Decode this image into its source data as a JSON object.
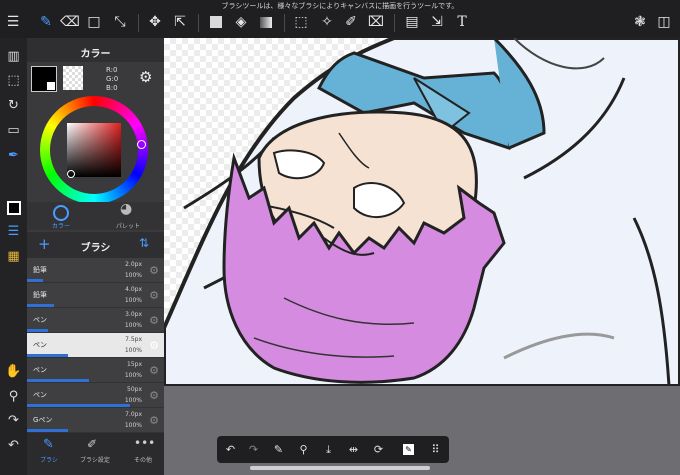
{
  "top_hint": "ブラシツールは、様々なブラシによりキャンバスに描画を行うツールです。",
  "color_panel": {
    "title": "カラー",
    "rgb": {
      "r": "R:0",
      "g": "G:0",
      "b": "B:0"
    },
    "tabs": [
      {
        "label": "カラー"
      },
      {
        "label": "パレット"
      }
    ]
  },
  "brush_panel": {
    "title": "ブラシ",
    "items": [
      {
        "name": "鉛筆",
        "size": "2.0px",
        "opacity": "100%",
        "bar": 0.12
      },
      {
        "name": "鉛筆",
        "size": "4.0px",
        "opacity": "100%",
        "bar": 0.2
      },
      {
        "name": "ペン",
        "size": "3.0px",
        "opacity": "100%",
        "bar": 0.15
      },
      {
        "name": "ペン",
        "size": "7.5px",
        "opacity": "100%",
        "bar": 0.3,
        "selected": true
      },
      {
        "name": "ペン",
        "size": "15px",
        "opacity": "100%",
        "bar": 0.45
      },
      {
        "name": "ペン",
        "size": "50px",
        "opacity": "100%",
        "bar": 0.75
      },
      {
        "name": "Gペン",
        "size": "7.0px",
        "opacity": "100%",
        "bar": 0.3
      }
    ],
    "bottom_tabs": [
      {
        "label": "ブラシ"
      },
      {
        "label": "ブラシ設定"
      },
      {
        "label": "その他"
      }
    ]
  },
  "colors": {
    "accent": "#2f6fd6",
    "hair": "#d58be0",
    "shirt_blue": "#66b2d6",
    "skin": "#f6e2d2"
  }
}
